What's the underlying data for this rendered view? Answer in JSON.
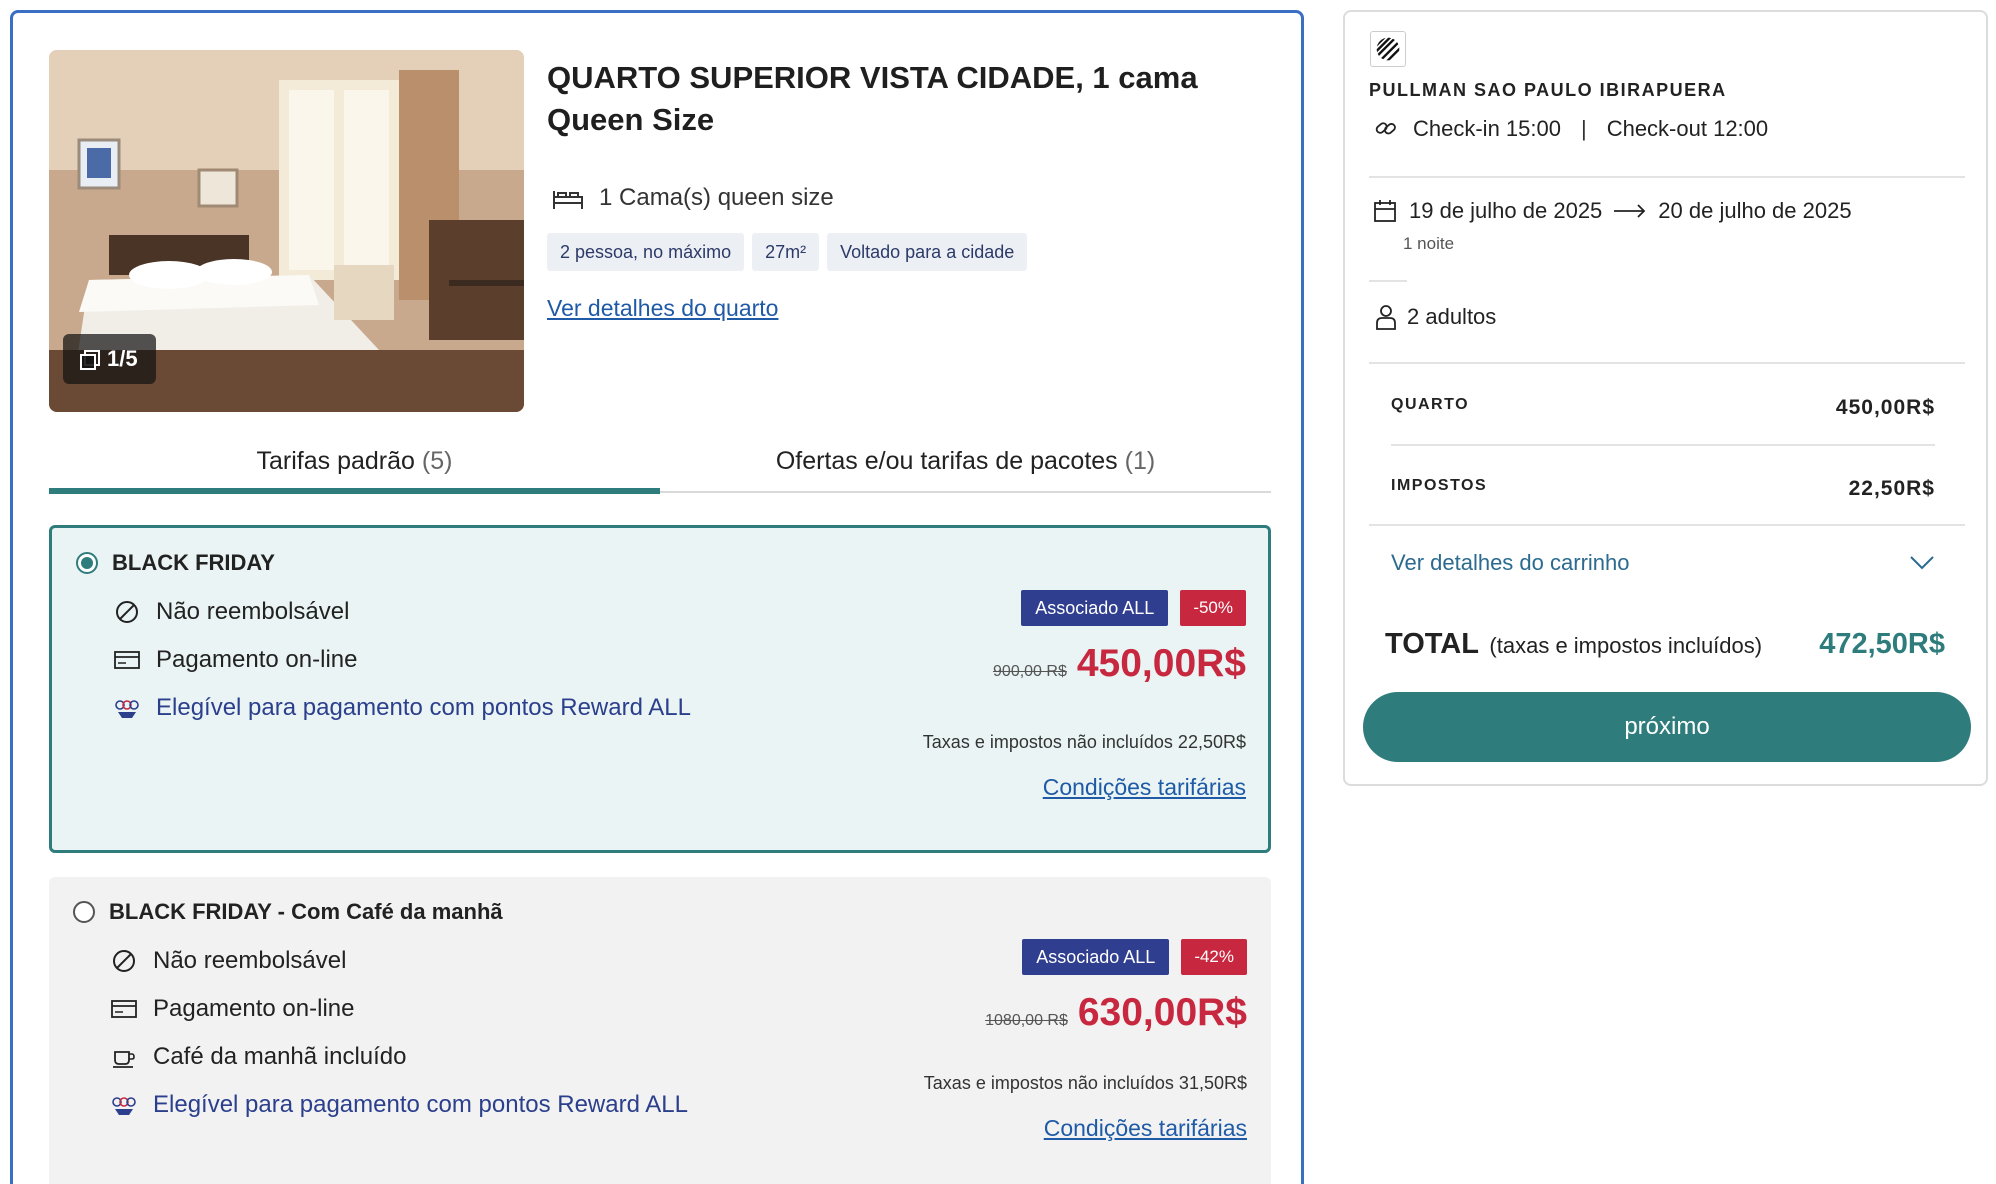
{
  "room": {
    "title": "QUARTO SUPERIOR VISTA CIDADE, 1 cama Queen Size",
    "photo_counter": "1/5",
    "bed": "1 Cama(s) queen size",
    "chips": [
      "2 pessoa, no máximo",
      "27m²",
      "Voltado para a cidade"
    ],
    "details_link": "Ver detalhes do quarto"
  },
  "tabs": [
    {
      "label": "Tarifas padrão",
      "count": "(5)",
      "active": true
    },
    {
      "label": "Ofertas e/ou tarifas de pacotes",
      "count": "(1)",
      "active": false
    }
  ],
  "rates": [
    {
      "name": "BLACK FRIDAY",
      "selected": true,
      "features": [
        {
          "icon": "no-refund-icon",
          "text": "Não reembolsável"
        },
        {
          "icon": "card-icon",
          "text": "Pagamento on-line"
        },
        {
          "icon": "reward-icon",
          "text": "Elegível para pagamento com pontos Reward ALL",
          "link": true
        }
      ],
      "badge": "Associado ALL",
      "discount": "-50%",
      "old_price": "900,00 R$",
      "price": "450,00R$",
      "taxes": "Taxas e impostos não incluídos 22,50R$",
      "conditions": "Condições tarifárias"
    },
    {
      "name": "BLACK FRIDAY - Com Café da manhã",
      "selected": false,
      "features": [
        {
          "icon": "no-refund-icon",
          "text": "Não reembolsável"
        },
        {
          "icon": "card-icon",
          "text": "Pagamento on-line"
        },
        {
          "icon": "coffee-icon",
          "text": "Café da manhã incluído"
        },
        {
          "icon": "reward-icon",
          "text": "Elegível para pagamento com pontos Reward ALL",
          "link": true
        }
      ],
      "badge": "Associado ALL",
      "discount": "-42%",
      "old_price": "1080,00 R$",
      "price": "630,00R$",
      "taxes": "Taxas e impostos não incluídos 31,50R$",
      "conditions": "Condições tarifárias"
    }
  ],
  "summary": {
    "hotel": "PULLMAN SAO PAULO IBIRAPUERA",
    "checkin": "Check-in 15:00",
    "separator": "|",
    "checkout": "Check-out 12:00",
    "date_from": "19 de julho de 2025",
    "date_to": "20 de julho de 2025",
    "nights": "1 noite",
    "guests": "2 adultos",
    "room_label": "QUARTO",
    "room_amount": "450,00R$",
    "tax_label": "IMPOSTOS",
    "tax_amount": "22,50R$",
    "cart_link": "Ver detalhes do carrinho",
    "total_label": "TOTAL",
    "total_note": "(taxas e impostos incluídos)",
    "total_amount": "472,50R$",
    "next_button": "próximo"
  },
  "colors": {
    "accent": "#2f7c7c",
    "price_red": "#c8283f",
    "badge_blue": "#2f3e8f",
    "card_border": "#3a6fc4"
  }
}
